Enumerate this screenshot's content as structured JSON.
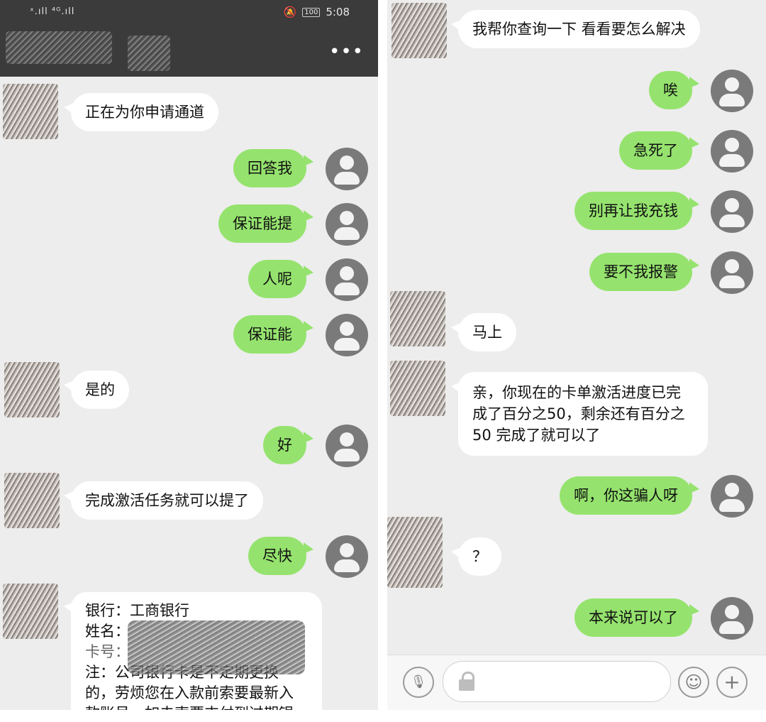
{
  "status_bar": {
    "signal": "ˣ.ıll ⁴ᴳ.ıll",
    "battery": "100",
    "time": "5:08"
  },
  "header": {
    "more": "•••"
  },
  "left_messages": [
    {
      "side": "in",
      "text": "正在为你申请通道"
    },
    {
      "side": "out",
      "text": "回答我"
    },
    {
      "side": "out",
      "text": "保证能提"
    },
    {
      "side": "out",
      "text": "人呢"
    },
    {
      "side": "out",
      "text": "保证能"
    },
    {
      "side": "in",
      "text": "是的"
    },
    {
      "side": "out",
      "text": "好"
    },
    {
      "side": "in",
      "text": "完成激活任务就可以提了"
    },
    {
      "side": "out",
      "text": "尽快"
    }
  ],
  "bank_card": {
    "line1": "银行：工商银行",
    "line2": "姓名：",
    "line3": "卡号：",
    "line4": "注：公司银行卡是不定期更换",
    "line5": "的，劳烦您在入款前索要最新入",
    "line6": "款账号，如未索要支付到过期银"
  },
  "right_messages": [
    {
      "side": "in",
      "text": "我帮你查询一下 看看要怎么解决"
    },
    {
      "side": "out",
      "text": "唉"
    },
    {
      "side": "out",
      "text": "急死了"
    },
    {
      "side": "out",
      "text": "别再让我充钱"
    },
    {
      "side": "out",
      "text": "要不我报警"
    },
    {
      "side": "in",
      "text": "马上"
    },
    {
      "side": "in",
      "text": "亲，你现在的卡单激活进度已完成了百分之50，剩余还有百分之50 完成了就可以了"
    },
    {
      "side": "out",
      "text": "啊，你这骗人呀"
    },
    {
      "side": "in",
      "text": "？"
    },
    {
      "side": "out",
      "text": "本来说可以了"
    }
  ],
  "input_bar": {
    "voice": "🎙",
    "emoji": "☺",
    "plus": "+"
  },
  "colors": {
    "self_bubble": "#95e36e",
    "other_bubble": "#ffffff",
    "chat_bg": "#ededed",
    "header": "#3b3b3b"
  }
}
